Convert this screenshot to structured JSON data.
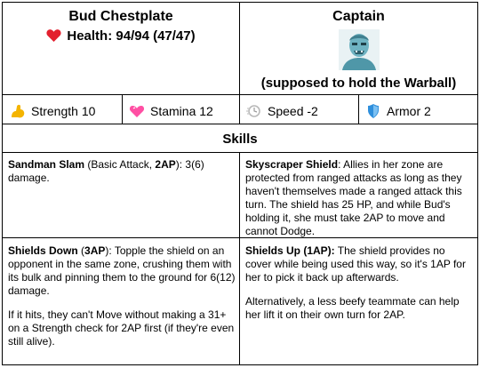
{
  "character": {
    "name": "Bud Chestplate",
    "health_label": "Health: 94/94 (47/47)",
    "role": "Captain",
    "role_note": "(supposed to hold the Warball)"
  },
  "stats": [
    {
      "icon": "flexed-biceps-icon",
      "label": "Strength 10"
    },
    {
      "icon": "heart-icon",
      "label": "Stamina 12"
    },
    {
      "icon": "speed-icon",
      "label": "Speed -2"
    },
    {
      "icon": "shield-icon",
      "label": "Armor 2"
    }
  ],
  "skills_title": "Skills",
  "skills": {
    "sandman_slam": {
      "name": "Sandman Slam",
      "cost_prefix": " (Basic Attack, ",
      "cost": "2AP",
      "cost_suffix": "): 3(6) damage."
    },
    "skyscraper_shield": {
      "name": "Skyscraper Shield",
      "text": ": Allies in her zone are protected from ranged attacks as long as they haven't themselves made a ranged attack this turn. The shield has 25 HP, and while Bud's holding it, she must take 2AP to move and cannot Dodge."
    },
    "shields_down": {
      "name": "Shields Down",
      "cost_prefix": " (",
      "cost": "3AP",
      "text": "):  Topple the shield on an opponent in the same zone, crushing them with its bulk and pinning them to the ground for 6(12) damage.",
      "text2": "If it hits, they can't Move without making a 31+ on a Strength check for 2AP first (if they're even still alive)."
    },
    "shields_up": {
      "name": "Shields Up (1AP):",
      "text": " The shield provides no cover while being used this way, so it's 1AP for her to pick it back up afterwards.",
      "text2": "Alternatively, a less beefy teammate can help her lift it on their own turn for 2AP."
    }
  },
  "colors": {
    "border": "#000000",
    "heart": "#e3202e",
    "biceps": "#f4b400",
    "stamina_heart": "#ff4fa3",
    "shield": "#2f8fdc",
    "portrait": "#5ea8b8"
  }
}
